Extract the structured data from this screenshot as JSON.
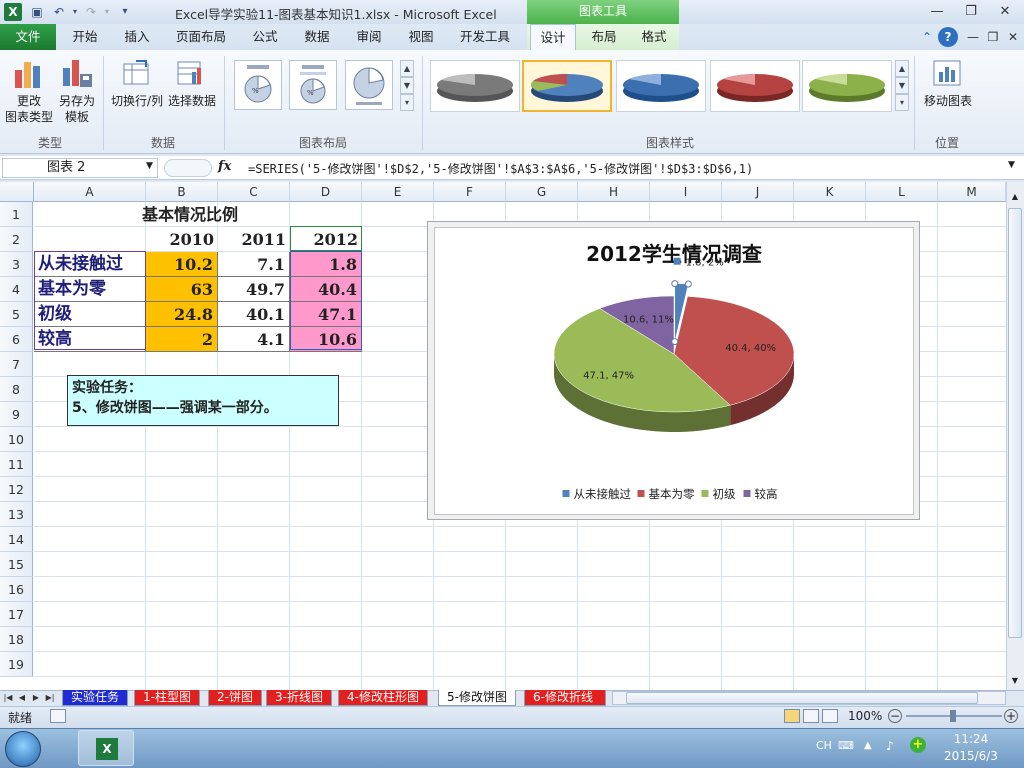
{
  "window": {
    "title": "Excel导学实验11-图表基本知识1.xlsx  -  Microsoft Excel",
    "chart_tools": "图表工具"
  },
  "tabs": {
    "file": "文件",
    "home": "开始",
    "insert": "插入",
    "page_layout": "页面布局",
    "formulas": "公式",
    "data": "数据",
    "review": "审阅",
    "view": "视图",
    "developer": "开发工具",
    "design": "设计",
    "layout": "布局",
    "format": "格式"
  },
  "ribbon": {
    "change_type_l1": "更改",
    "change_type_l2": "图表类型",
    "save_template_l1": "另存为",
    "save_template_l2": "模板",
    "switch_row_col": "切换行/列",
    "select_data": "选择数据",
    "move_chart": "移动图表",
    "groups": {
      "type": "类型",
      "data": "数据",
      "layouts": "图表布局",
      "styles": "图表样式",
      "location": "位置"
    }
  },
  "formula_bar": {
    "name_box": "图表 2",
    "fx": "fx",
    "formula": "=SERIES('5-修改饼图'!$D$2,'5-修改饼图'!$A$3:$A$6,'5-修改饼图'!$D$3:$D$6,1)"
  },
  "columns": [
    "A",
    "B",
    "C",
    "D",
    "E",
    "F",
    "G",
    "H",
    "I",
    "J",
    "K",
    "L",
    "M"
  ],
  "rows": [
    "1",
    "2",
    "3",
    "4",
    "5",
    "6",
    "7",
    "8",
    "9",
    "10",
    "11",
    "12",
    "13",
    "14",
    "15",
    "16",
    "17",
    "18",
    "19"
  ],
  "sheet": {
    "title": "基本情况比例",
    "years": [
      "2010",
      "2011",
      "2012"
    ],
    "table": [
      {
        "label": "从未接触过",
        "b": "10.2",
        "c": "7.1",
        "d": "1.8"
      },
      {
        "label": "基本为零",
        "b": "63",
        "c": "49.7",
        "d": "40.4"
      },
      {
        "label": "初级",
        "b": "24.8",
        "c": "40.1",
        "d": "47.1"
      },
      {
        "label": "较高",
        "b": "2",
        "c": "4.1",
        "d": "10.6"
      }
    ],
    "note_line1": "实验任务：",
    "note_line2": "5、修改饼图——强调某一部分。"
  },
  "chart_data": {
    "type": "pie",
    "title": "2012学生情况调查",
    "categories": [
      "从未接触过",
      "基本为零",
      "初级",
      "较高"
    ],
    "values": [
      1.8,
      40.4,
      47.1,
      10.6
    ],
    "data_labels": [
      "1.8, 2%",
      "40.4, 40%",
      "47.1, 47%",
      "10.6, 11%"
    ],
    "colors": [
      "#4f81bd",
      "#c0504d",
      "#9bbb59",
      "#8064a2"
    ],
    "legend": "bottom",
    "exploded": "从未接触过",
    "style": "3d"
  },
  "sheet_tabs": [
    "实验任务",
    "1-柱型图",
    "2-饼图",
    "3-折线图",
    "4-修改柱形图",
    "5-修改饼图",
    "6-修改折线"
  ],
  "status": {
    "ready": "就绪",
    "zoom": "100%"
  },
  "taskbar": {
    "lang": "CH",
    "time": "11:24",
    "date": "2015/6/3"
  },
  "colors": {
    "file_tab": "#1c7a31",
    "fill_2010": "#ffc000",
    "fill_2012": "#ff99cc",
    "label_text": "#1f1f7a",
    "note_bg": "#ccffff"
  }
}
